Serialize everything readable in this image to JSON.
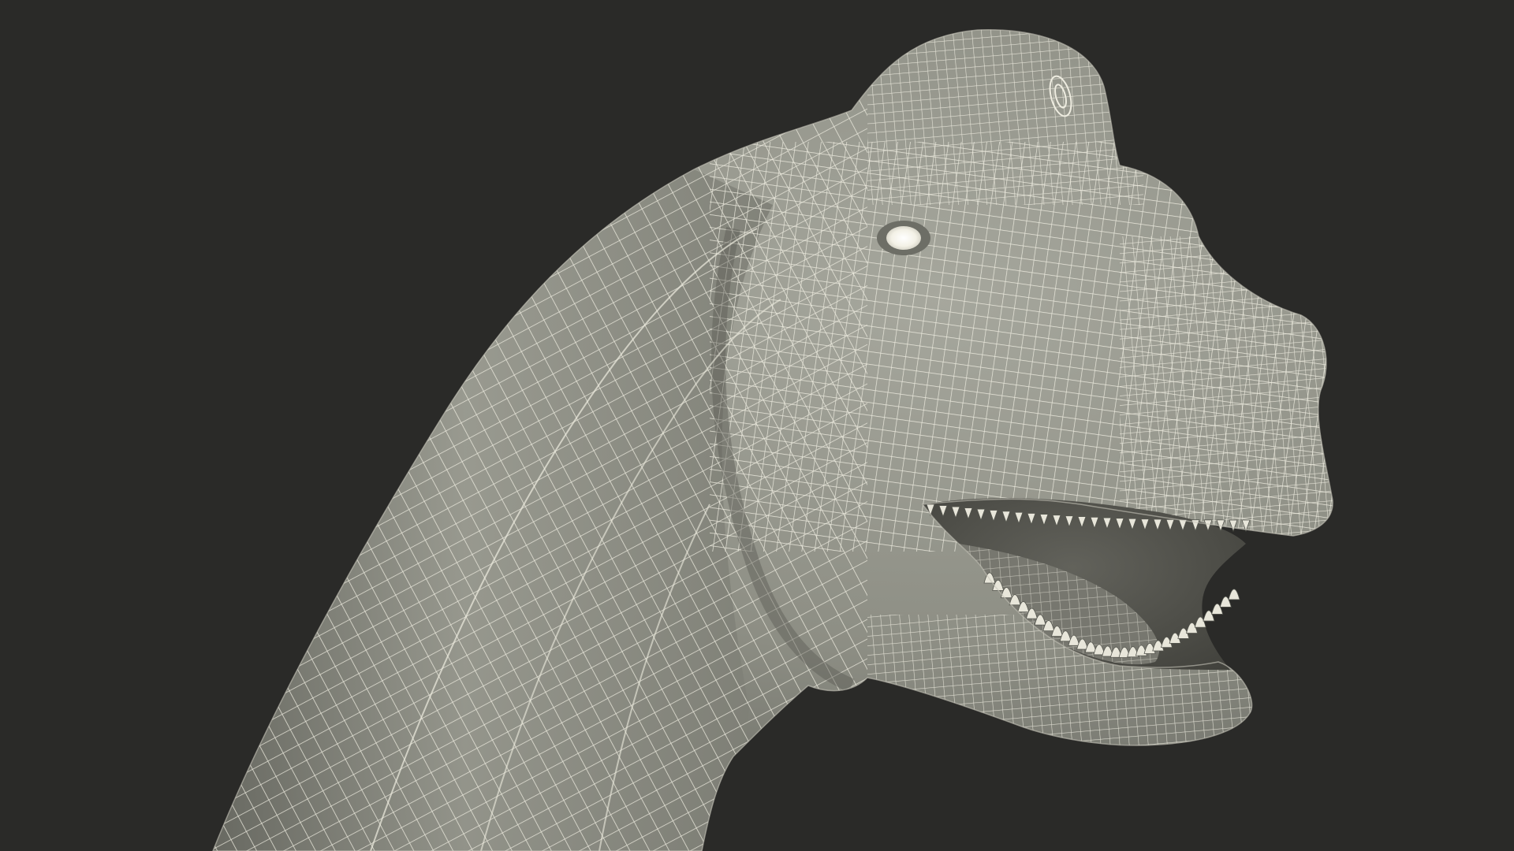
{
  "scene": {
    "subject": "brachiosaurus-head-wireframe",
    "colors": {
      "background": "#2a2a28",
      "mesh_fill": "#8d8e84",
      "mesh_shadow": "#5f605a",
      "mesh_highlight": "#a6a79d",
      "wire": "#eeece0",
      "mouth_interior": "#4a4a44",
      "tongue": "#77776f",
      "teeth": "#e8e6da",
      "eye": "#f3f1e6"
    }
  }
}
